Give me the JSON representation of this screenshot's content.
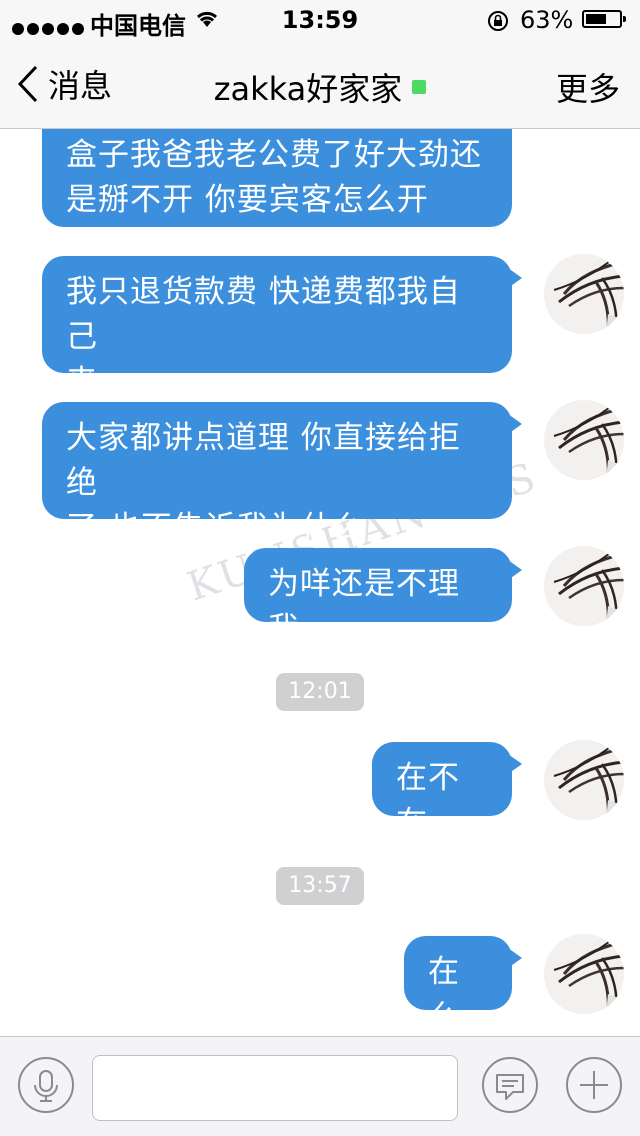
{
  "status_bar": {
    "carrier": "中国电信",
    "time": "13:59",
    "battery_percent": "63%",
    "battery_level": 0.63
  },
  "nav": {
    "back_label": "消息",
    "title": "zakka好家家",
    "more_label": "更多",
    "online_color": "#4cd964"
  },
  "messages": [
    {
      "lines": [
        "盒子我爸我老公费了好大劲还",
        "是掰不开 你要宾客怎么开"
      ]
    },
    {
      "lines": [
        "我只退货款费 快递费都我自己",
        "来"
      ]
    },
    {
      "lines": [
        "大家都讲点道理 你直接给拒绝",
        "了 也不告诉我为什么"
      ]
    },
    {
      "lines": [
        "为咩还是不理我"
      ]
    },
    {
      "lines": [
        "在不在"
      ]
    },
    {
      "lines": [
        "在么"
      ]
    }
  ],
  "timestamps": [
    "12:01",
    "13:57"
  ],
  "watermark": "KUNSHAN BBS",
  "theme": {
    "bubble_color": "#3c8fdc",
    "bar_color": "#f7f7f8"
  },
  "icons": {
    "voice": "microphone-icon",
    "emoji": "chat-bubble-icon",
    "more": "plus-icon"
  }
}
